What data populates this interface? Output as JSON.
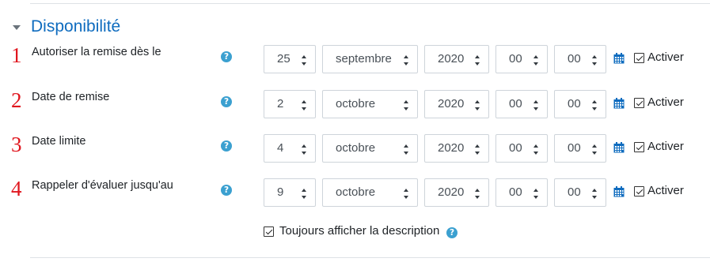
{
  "section": {
    "title": "Disponibilité"
  },
  "rows": [
    {
      "number": "1",
      "label": "Autoriser la remise dès le",
      "day": "25",
      "month": "septembre",
      "year": "2020",
      "hour": "00",
      "minute": "00",
      "enable_label": "Activer"
    },
    {
      "number": "2",
      "label": "Date de remise",
      "day": "2",
      "month": "octobre",
      "year": "2020",
      "hour": "00",
      "minute": "00",
      "enable_label": "Activer"
    },
    {
      "number": "3",
      "label": "Date limite",
      "day": "4",
      "month": "octobre",
      "year": "2020",
      "hour": "00",
      "minute": "00",
      "enable_label": "Activer"
    },
    {
      "number": "4",
      "label": "Rappeler d'évaluer jusqu'au",
      "day": "9",
      "month": "octobre",
      "year": "2020",
      "hour": "00",
      "minute": "00",
      "enable_label": "Activer"
    }
  ],
  "always_show_description": {
    "label": "Toujours afficher la description",
    "checked": true
  },
  "help_glyph": "?",
  "icons": {
    "section_toggle": "caret-down-icon",
    "help": "help-icon",
    "calendar": "calendar-icon",
    "checkbox": "checkbox-checked-icon"
  },
  "colors": {
    "accent": "#0f6cbf",
    "annotation": "#e0161e",
    "help": "#3ba0d0"
  }
}
